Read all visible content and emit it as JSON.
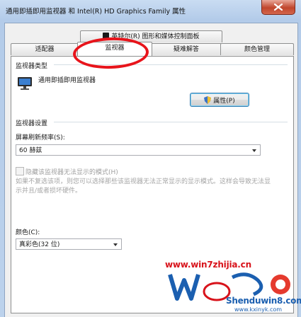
{
  "window": {
    "title": "通用即插即用监视器 和 Intel(R) HD Graphics Family 属性"
  },
  "tabs": {
    "row1": [
      {
        "label": "英特尔(R) 图形和媒体控制面板",
        "icon": "intel-graphics-icon"
      }
    ],
    "row2": [
      {
        "label": "适配器"
      },
      {
        "label": "监视器",
        "selected": true
      },
      {
        "label": "疑难解答"
      },
      {
        "label": "颜色管理"
      }
    ]
  },
  "monitor_type": {
    "heading": "监视器类型",
    "device_name": "通用即插即用监视器",
    "properties_button": "属性(P)"
  },
  "monitor_settings": {
    "heading": "监视器设置",
    "refresh_label": "屏幕刷新频率(S):",
    "refresh_value": "60 赫兹",
    "hide_modes_checkbox": "隐藏该监视器无法显示的模式(H)",
    "hide_modes_checked": false,
    "hint_text": "如果不复选该项，则您可以选择那些该监视器无法正常显示的显示模式。这样会导致无法显示并且/或者损坏硬件。"
  },
  "color": {
    "label": "颜色(C):",
    "value": "真彩色(32 位)"
  },
  "watermark": {
    "url": "www.win7zhijia.cn",
    "site": "Shenduwin8.com",
    "site_url": "www.kxinyk.com"
  },
  "colors": {
    "annotation_ring": "#e8141b",
    "watermark_red": "#d8131b",
    "watermark_blue": "#1b5fb0"
  }
}
